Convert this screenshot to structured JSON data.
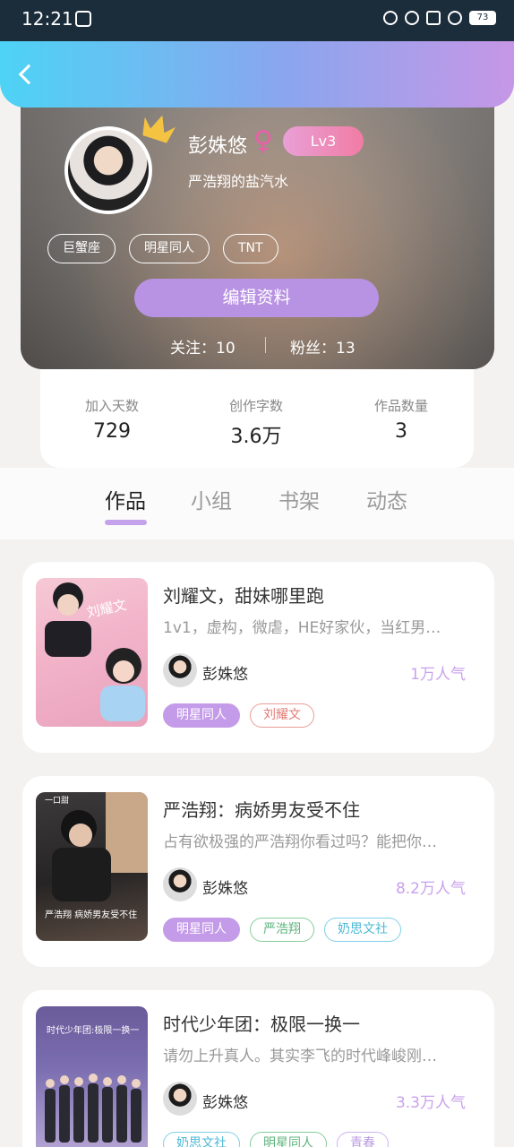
{
  "status": {
    "time": "12:21",
    "battery": "73"
  },
  "profile": {
    "name": "彭姝悠",
    "gender_symbol": "♀",
    "level": "Lv3",
    "signature": "严浩翔的盐汽水",
    "tags": [
      "巨蟹座",
      "明星同人",
      "TNT"
    ],
    "edit_label": "编辑资料",
    "follows": "关注：10",
    "fans": "粉丝：13"
  },
  "stats": [
    {
      "label": "加入天数",
      "value": "729"
    },
    {
      "label": "创作字数",
      "value": "3.6万"
    },
    {
      "label": "作品数量",
      "value": "3"
    }
  ],
  "tabs": [
    "作品",
    "小组",
    "书架",
    "动态"
  ],
  "works": [
    {
      "title": "刘耀文，甜妹哪里跑",
      "desc": "1v1，虚构，微虐，HE好家伙，当红男…",
      "author": "彭姝悠",
      "popularity": "1万人气",
      "tags": [
        "明星同人",
        "刘耀文"
      ],
      "cover_text": "刘耀文"
    },
    {
      "title": "严浩翔：病娇男友受不住",
      "desc": "占有欲极强的严浩翔你看过吗？能把你…",
      "author": "彭姝悠",
      "popularity": "8.2万人气",
      "tags": [
        "明星同人",
        "严浩翔",
        "奶思文社"
      ],
      "cover_text": "严浩翔 病娇男友受不住"
    },
    {
      "title": "时代少年团：极限一换一",
      "desc": "请勿上升真人。其实李飞的时代峰峻刚…",
      "author": "彭姝悠",
      "popularity": "3.3万人气",
      "tags": [
        "奶思文社",
        "明星同人",
        "青春"
      ],
      "cover_text": "时代少年团:极限一换一"
    }
  ],
  "colors": {
    "accent": "#c49be8",
    "header_start": "#4dd3f5",
    "header_end": "#c697e6"
  }
}
